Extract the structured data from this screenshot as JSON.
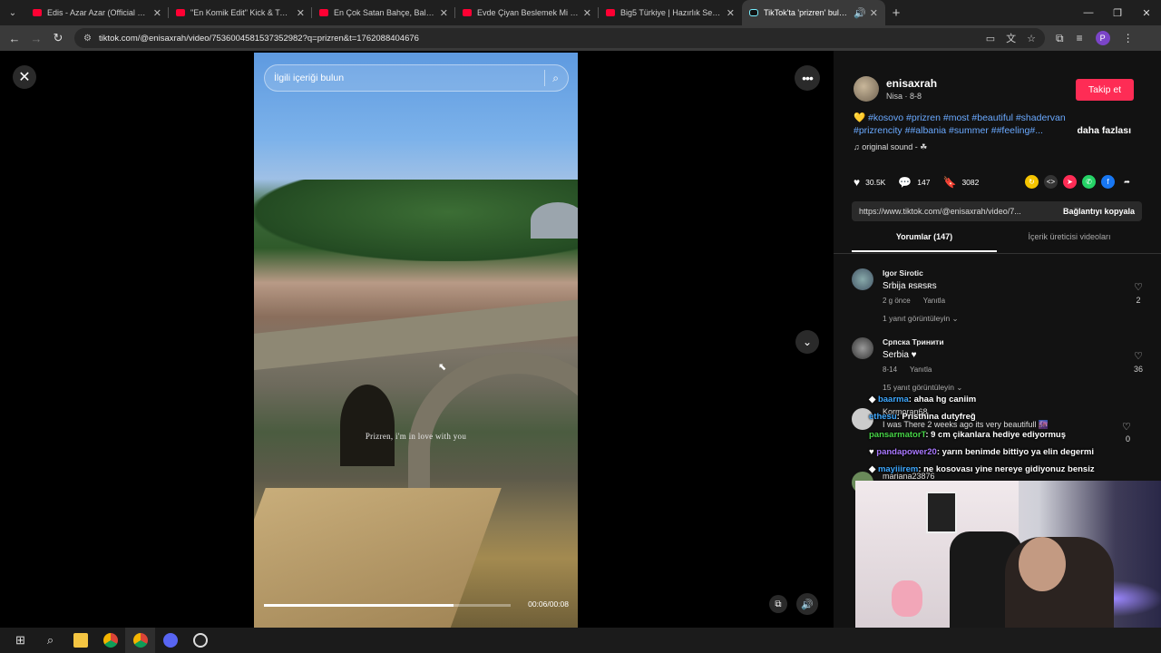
{
  "browser": {
    "tabs": [
      {
        "title": "Edis - Azar Azar (Official Video)",
        "favicon": "youtube-icon"
      },
      {
        "title": "\"En Komik Edit\" Kick & Twitch K",
        "favicon": "youtube-icon"
      },
      {
        "title": "En Çok Satan Bahçe, Balkon ve",
        "favicon": "youtube-icon"
      },
      {
        "title": "Evde Çiyan Beslemek Mi ? - You",
        "favicon": "youtube-icon"
      },
      {
        "title": "Big5 Türkiye | Hazırlık Sezonu 4",
        "favicon": "youtube-icon"
      },
      {
        "title": "TikTok'ta 'prizren' bulabilirs",
        "favicon": "tiktok-icon"
      }
    ],
    "url": "tiktok.com/@enisaxrah/video/7536004581537352982?q=prizren&t=1762088404676",
    "profile_initial": "P"
  },
  "video": {
    "search_placeholder": "İlgili içeriği bulun",
    "caption": "Prizren, i'm in love with you",
    "time": "00:06/00:08",
    "progress": 0.77
  },
  "post": {
    "username": "enisaxrah",
    "subtitle": "Nisa · 8-8",
    "follow_label": "Takip et",
    "emoji": "💛",
    "tags_line1": "#kosovo #prizren #most #beautiful #shadervan",
    "tags_line2": "#prizrencity ##albania #summer ##feeling#...",
    "more_label": "daha fazlası",
    "sound": "original sound - ☘",
    "likes": "30.5K",
    "comments": "147",
    "saves": "3082",
    "share_url": "https://www.tiktok.com/@enisaxrah/video/7...",
    "copy_label": "Bağlantıyı kopyala",
    "tab_comments": "Yorumlar (147)",
    "tab_creator": "İçerik üreticisi videoları"
  },
  "comments": [
    {
      "name": "Igor Sirotic",
      "text": "Srbija ʀsʀsʀs",
      "time": "2 g önce",
      "reply": "Yanıtla",
      "replies": "1 yanıt görüntüleyin ⌄",
      "likes": "2"
    },
    {
      "name": "Српска Тринити",
      "text": "Serbia ♥",
      "time": "8-14",
      "reply": "Yanıtla",
      "replies": "15 yanıt görüntüleyin ⌄",
      "likes": "36"
    }
  ],
  "partial_comments": {
    "name3": "Kormoran68",
    "text3": "I was There 2 weeks ago its very beautifull 🌆",
    "likes3": "0",
    "name4": "mariana23876"
  },
  "chat": [
    {
      "user": "baarma",
      "msg": ": ahaa hg caniim",
      "color": "#3ea8ff"
    },
    {
      "user": "ethesu",
      "msg": ": Pristhina dutyfreğ",
      "color": "#3ea8ff"
    },
    {
      "user": "pansarmatorT",
      "msg": ": 9 cm çikanlara hediye ediyormuş",
      "color": "#47d447"
    },
    {
      "user": "pandapower20",
      "msg": ": yarın benimde bittiyo ya elin degermi",
      "color": "#a978ff"
    },
    {
      "user": "mayiiirem",
      "msg": ": ne kosovası yine nereye gidiyonuz bensiz",
      "color": "#3ea8ff"
    }
  ]
}
